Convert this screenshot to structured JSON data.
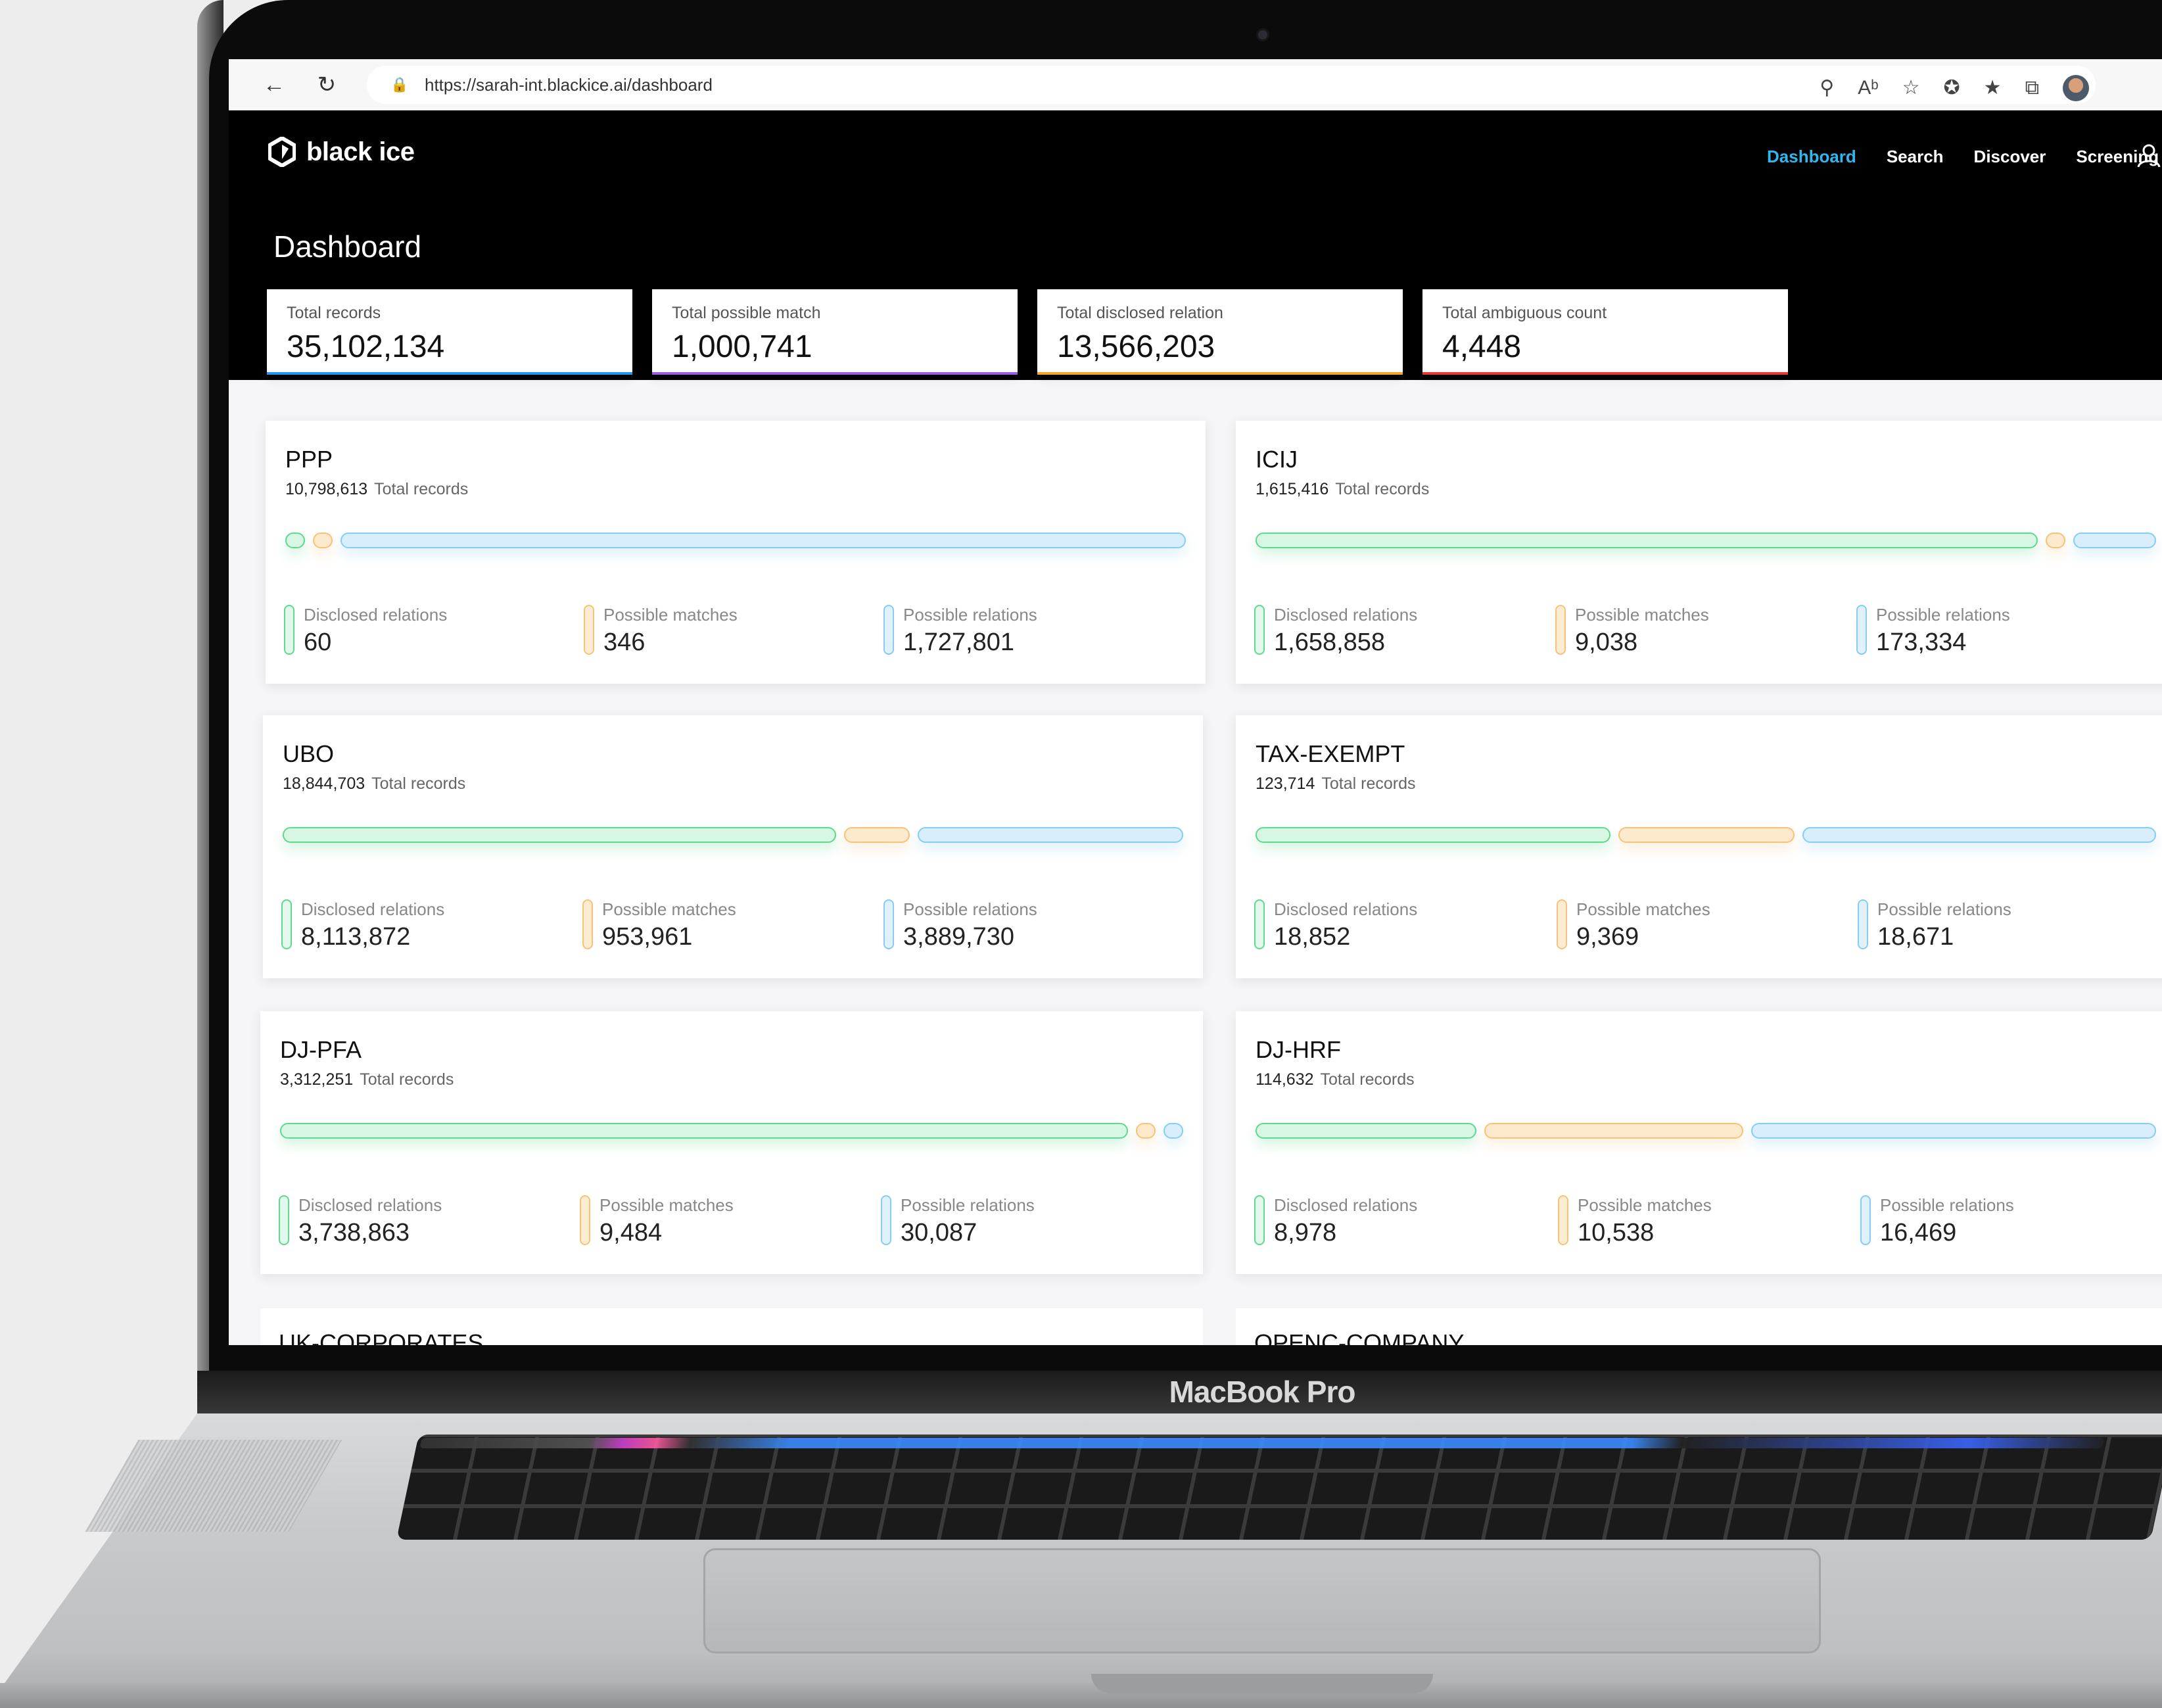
{
  "device": {
    "label": "MacBook Pro"
  },
  "browser": {
    "url": "https://sarah-int.blackice.ai/dashboard"
  },
  "app": {
    "brand": "black ice",
    "nav": [
      "Dashboard",
      "Search",
      "Discover",
      "Screening"
    ],
    "active_nav": "Dashboard",
    "page_title": "Dashboard",
    "colors": {
      "accent": "#2fb7ee",
      "green": "#5ed98d",
      "orange": "#f7c27a",
      "blue": "#86cdf3",
      "purple": "#9b5de5",
      "red": "#e53935",
      "amber": "#f5a623",
      "stat_blue": "#2196f3"
    }
  },
  "stats": [
    {
      "label": "Total records",
      "value": "35,102,134"
    },
    {
      "label": "Total possible match",
      "value": "1,000,741"
    },
    {
      "label": "Total disclosed relation",
      "value": "13,566,203"
    },
    {
      "label": "Total ambiguous count",
      "value": "4,448"
    }
  ],
  "sources": [
    {
      "name": "PPP",
      "total": "10,798,613",
      "total_label": "Total records",
      "disclosed_label": "Disclosed relations",
      "disclosed": "60",
      "matches_label": "Possible matches",
      "matches": "346",
      "relations_label": "Possible relations",
      "relations": "1,727,801"
    },
    {
      "name": "ICIJ",
      "total": "1,615,416",
      "total_label": "Total records",
      "disclosed_label": "Disclosed relations",
      "disclosed": "1,658,858",
      "matches_label": "Possible matches",
      "matches": "9,038",
      "relations_label": "Possible relations",
      "relations": "173,334"
    },
    {
      "name": "UBO",
      "total": "18,844,703",
      "total_label": "Total records",
      "disclosed_label": "Disclosed relations",
      "disclosed": "8,113,872",
      "matches_label": "Possible matches",
      "matches": "953,961",
      "relations_label": "Possible relations",
      "relations": "3,889,730"
    },
    {
      "name": "TAX-EXEMPT",
      "total": "123,714",
      "total_label": "Total records",
      "disclosed_label": "Disclosed relations",
      "disclosed": "18,852",
      "matches_label": "Possible matches",
      "matches": "9,369",
      "relations_label": "Possible relations",
      "relations": "18,671"
    },
    {
      "name": "DJ-PFA",
      "total": "3,312,251",
      "total_label": "Total records",
      "disclosed_label": "Disclosed relations",
      "disclosed": "3,738,863",
      "matches_label": "Possible matches",
      "matches": "9,484",
      "relations_label": "Possible relations",
      "relations": "30,087"
    },
    {
      "name": "DJ-HRF",
      "total": "114,632",
      "total_label": "Total records",
      "disclosed_label": "Disclosed relations",
      "disclosed": "8,978",
      "matches_label": "Possible matches",
      "matches": "10,538",
      "relations_label": "Possible relations",
      "relations": "16,469"
    }
  ],
  "partial_sources": [
    "UK-CORPORATES",
    "OPENC-COMPANY"
  ]
}
